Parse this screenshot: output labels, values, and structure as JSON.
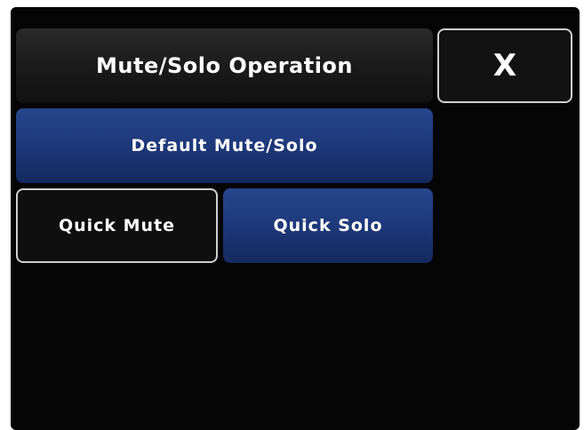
{
  "dialog": {
    "title": "Mute/Solo Operation",
    "close_label": "X"
  },
  "options": {
    "default_label": "Default Mute/Solo",
    "quick_mute_label": "Quick Mute",
    "quick_solo_label": "Quick Solo",
    "selected": "Quick Mute"
  },
  "colors": {
    "screen_background": "#050505",
    "button_blue": "#1f3a7c",
    "button_dark": "#0f0f0f",
    "selected_border": "#cfcfcf",
    "text": "#ffffff"
  }
}
